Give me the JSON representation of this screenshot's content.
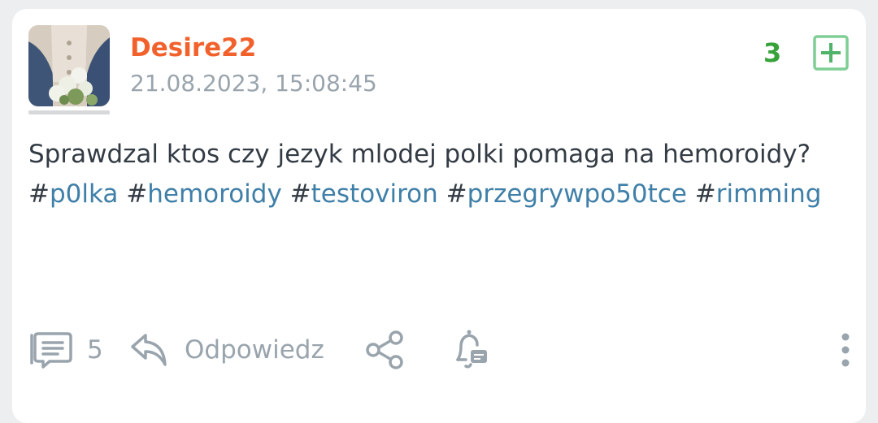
{
  "post": {
    "author": "Desire22",
    "timestamp": "21.08.2023, 15:08:45",
    "votes": "3",
    "text_line": "Sprawdzal ktos czy jezyk mlodej polki pomaga na hemoroidy?",
    "tags": [
      {
        "hash": "#",
        "name": "p0lka"
      },
      {
        "hash": "#",
        "name": "hemoroidy"
      },
      {
        "hash": "#",
        "name": "testoviron"
      },
      {
        "hash": "#",
        "name": "przegrywpo50tce"
      },
      {
        "hash": "#",
        "name": "rimming"
      }
    ]
  },
  "actions": {
    "comments_count": "5",
    "reply_label": "Odpowiedz"
  },
  "icons": {
    "plus": "plus-square-icon",
    "comments": "comments-icon",
    "reply": "reply-arrow-icon",
    "share": "share-icon",
    "notify": "bell-icon",
    "more": "more-vertical-icon"
  },
  "colors": {
    "author": "#f2612b",
    "votes": "#36a33a",
    "tags": "#3f7fa8",
    "muted": "#99a4ad"
  }
}
